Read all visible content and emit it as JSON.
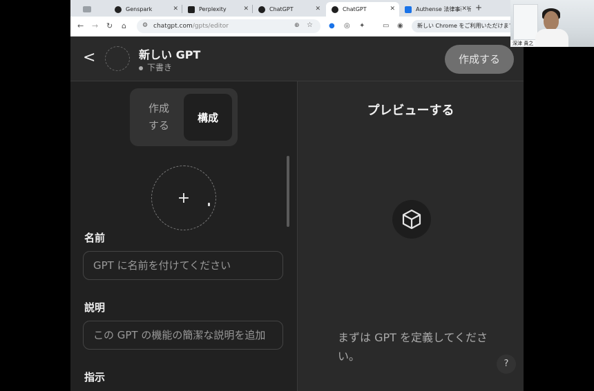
{
  "browser": {
    "tabs": [
      {
        "label": "",
        "favicon_color": "#9aa0a6",
        "active": false
      },
      {
        "label": "Genspark",
        "favicon_color": "#222222",
        "active": false
      },
      {
        "label": "Perplexity",
        "favicon_color": "#1f1f1f",
        "active": false
      },
      {
        "label": "ChatGPT",
        "favicon_color": "#1f1f1f",
        "active": false
      },
      {
        "label": "ChatGPT",
        "favicon_color": "#1f1f1f",
        "active": true
      },
      {
        "label": "Authense 法律事務所",
        "favicon_color": "#1a73e8",
        "active": false
      }
    ],
    "close_glyph": "✕",
    "new_tab_glyph": "+",
    "url_host": "chatgpt.com",
    "url_path": "/gpts/editor",
    "chrome_badge": "新しい Chrome をご利用いただけます",
    "icons": [
      "back-icon",
      "forward-icon",
      "reload-icon",
      "home-icon",
      "site-info-icon",
      "zoom-icon",
      "bookmark-star-icon",
      "extension-icon",
      "camera-icon",
      "puzzle-icon",
      "cast-icon",
      "profile-icon"
    ]
  },
  "header": {
    "back_glyph": "<",
    "title": "新しい GPT",
    "status": "下書き",
    "create_label": "作成する"
  },
  "editor": {
    "seg_create": "作成\nする",
    "seg_configure": "構成",
    "upload_glyph": "+",
    "name_label": "名前",
    "name_placeholder": "GPT に名前を付けてください",
    "desc_label": "説明",
    "desc_placeholder": "この GPT の機能の簡潔な説明を追加",
    "instructions_label": "指示"
  },
  "preview": {
    "title": "プレビューする",
    "hint": "まずは GPT を定義してください。",
    "help_label": "?"
  },
  "webcam": {
    "name_tag": "深津 貴之"
  },
  "colors": {
    "app_bg": "#212121",
    "panel_bg": "#2a2a2a",
    "button_gray": "#6f6f6f"
  }
}
